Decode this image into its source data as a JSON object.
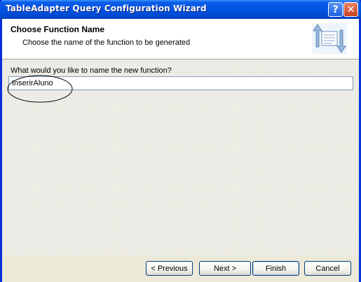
{
  "window": {
    "title": "TableAdapter Query Configuration Wizard",
    "help_label": "?",
    "close_label": "✕"
  },
  "header": {
    "title": "Choose Function Name",
    "subtitle": "Choose the name of the function to be generated",
    "icon": "wizard-swap-icon"
  },
  "form": {
    "question": "What would you like to name the new function?",
    "function_name_value": "InserirAluno"
  },
  "buttons": {
    "previous": "< Previous",
    "next": "Next >",
    "finish": "Finish",
    "cancel": "Cancel"
  },
  "colors": {
    "titlebar": "#0054e3",
    "window_bg": "#ece9d8",
    "input_border": "#7f9db9"
  }
}
